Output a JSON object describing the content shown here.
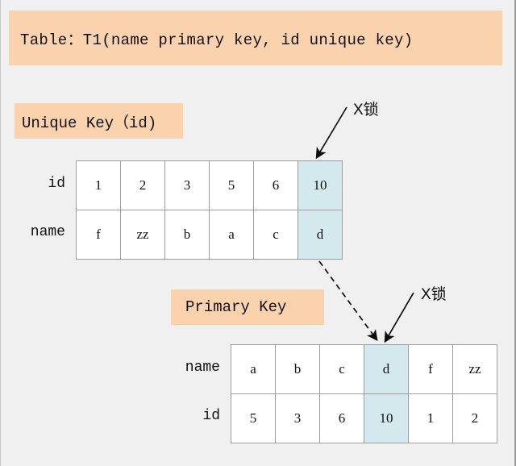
{
  "title": {
    "text": "Table：T1(name primary key, id unique key)",
    "background": "#fbd2ae"
  },
  "labels": {
    "unique_key": "Unique Key（id)",
    "primary_key": "Primary Key"
  },
  "annotations": {
    "x_lock_top": "X锁",
    "x_lock_bottom": "X锁"
  },
  "unique_index": {
    "row_labels": {
      "first": "id",
      "second": "name"
    },
    "rows": [
      {
        "name": "id",
        "cells": [
          "1",
          "2",
          "3",
          "5",
          "6",
          "10"
        ]
      },
      {
        "name": "name",
        "cells": [
          "f",
          "zz",
          "b",
          "a",
          "c",
          "d"
        ]
      }
    ],
    "highlight_column": 5
  },
  "primary_index": {
    "row_labels": {
      "first": "name",
      "second": "id"
    },
    "rows": [
      {
        "name": "name",
        "cells": [
          "a",
          "b",
          "c",
          "d",
          "f",
          "zz"
        ]
      },
      {
        "name": "id",
        "cells": [
          "5",
          "3",
          "6",
          "10",
          "1",
          "2"
        ]
      }
    ],
    "highlight_column": 3
  },
  "colors": {
    "page_background": "#f0f0f0",
    "peach": "#fbd2ae",
    "highlight_cell": "#d4e9ee",
    "grid_border": "#9d9d9d",
    "arrow": "#0c0c0c"
  }
}
